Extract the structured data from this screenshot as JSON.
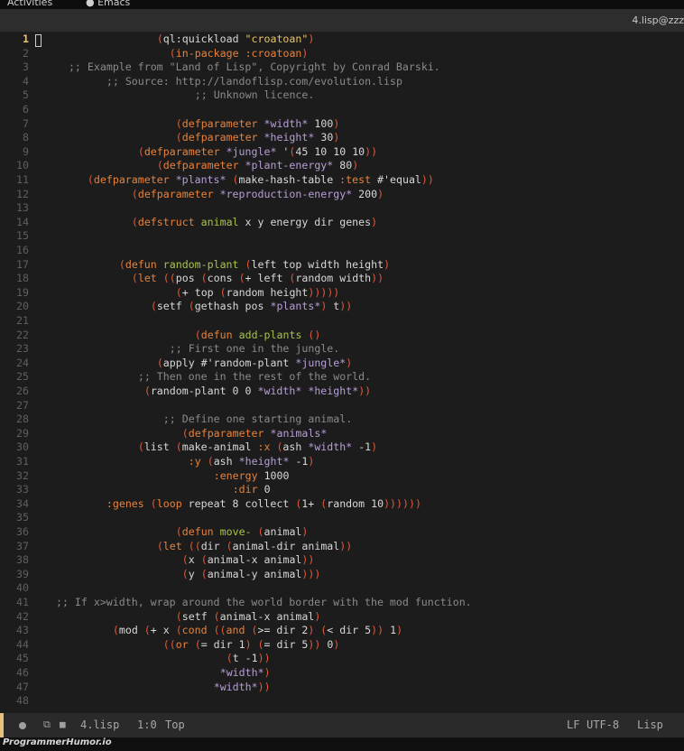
{
  "tab": {
    "title": "4.lisp@zzz"
  },
  "colors": {
    "background": "#1c1c1c",
    "paren": "#e05a3a",
    "keyword": "#e8823a",
    "function_name": "#a6c34a",
    "string": "#e9c46a",
    "comment": "#8a8a8a",
    "variable": "#b79fd6",
    "text": "#d8d8d8",
    "current_line_number": "#e8c07d"
  },
  "editor": {
    "current_line": 1,
    "lines": [
      {
        "n": "1",
        "indent": 18,
        "tokens": [
          [
            "p",
            "("
          ],
          [
            "t",
            "ql:quickload "
          ],
          [
            "s",
            "\"croatoan\""
          ],
          [
            "p",
            ")"
          ]
        ]
      },
      {
        "n": "2",
        "indent": 20,
        "tokens": [
          [
            "p",
            "("
          ],
          [
            "k",
            "in-package"
          ],
          [
            "t",
            " "
          ],
          [
            "k",
            ":croatoan"
          ],
          [
            "p",
            ")"
          ]
        ]
      },
      {
        "n": "3",
        "indent": 4,
        "tokens": [
          [
            "c",
            ";; Example from \"Land of Lisp\", Copyright by Conrad Barski."
          ]
        ]
      },
      {
        "n": "4",
        "indent": 10,
        "tokens": [
          [
            "c",
            ";; Source: http://landoflisp.com/evolution.lisp"
          ]
        ]
      },
      {
        "n": "5",
        "indent": 24,
        "tokens": [
          [
            "c",
            ";; Unknown licence."
          ]
        ]
      },
      {
        "n": "6",
        "indent": 0,
        "tokens": []
      },
      {
        "n": "7",
        "indent": 21,
        "tokens": [
          [
            "p",
            "("
          ],
          [
            "k",
            "defparameter"
          ],
          [
            "t",
            " "
          ],
          [
            "v",
            "*width*"
          ],
          [
            "t",
            " 100"
          ],
          [
            "p",
            ")"
          ]
        ]
      },
      {
        "n": "8",
        "indent": 21,
        "tokens": [
          [
            "p",
            "("
          ],
          [
            "k",
            "defparameter"
          ],
          [
            "t",
            " "
          ],
          [
            "v",
            "*height*"
          ],
          [
            "t",
            " 30"
          ],
          [
            "p",
            ")"
          ]
        ]
      },
      {
        "n": "9",
        "indent": 15,
        "tokens": [
          [
            "p",
            "("
          ],
          [
            "k",
            "defparameter"
          ],
          [
            "t",
            " "
          ],
          [
            "v",
            "*jungle*"
          ],
          [
            "t",
            " '"
          ],
          [
            "p",
            "("
          ],
          [
            "t",
            "45 10 10 10"
          ],
          [
            "p",
            "))"
          ]
        ]
      },
      {
        "n": "10",
        "indent": 18,
        "tokens": [
          [
            "p",
            "("
          ],
          [
            "k",
            "defparameter"
          ],
          [
            "t",
            " "
          ],
          [
            "v",
            "*plant-energy*"
          ],
          [
            "t",
            " 80"
          ],
          [
            "p",
            ")"
          ]
        ]
      },
      {
        "n": "11",
        "indent": 7,
        "tokens": [
          [
            "p",
            "("
          ],
          [
            "k",
            "defparameter"
          ],
          [
            "t",
            " "
          ],
          [
            "v",
            "*plants*"
          ],
          [
            "t",
            " "
          ],
          [
            "p",
            "("
          ],
          [
            "t",
            "make-hash-table "
          ],
          [
            "k",
            ":test"
          ],
          [
            "t",
            " #'equal"
          ],
          [
            "p",
            "))"
          ]
        ]
      },
      {
        "n": "12",
        "indent": 14,
        "tokens": [
          [
            "p",
            "("
          ],
          [
            "k",
            "defparameter"
          ],
          [
            "t",
            " "
          ],
          [
            "v",
            "*reproduction-energy*"
          ],
          [
            "t",
            " 200"
          ],
          [
            "p",
            ")"
          ]
        ]
      },
      {
        "n": "13",
        "indent": 0,
        "tokens": []
      },
      {
        "n": "14",
        "indent": 14,
        "tokens": [
          [
            "p",
            "("
          ],
          [
            "k",
            "defstruct"
          ],
          [
            "t",
            " "
          ],
          [
            "f",
            "animal"
          ],
          [
            "t",
            " x y energy dir genes"
          ],
          [
            "p",
            ")"
          ]
        ]
      },
      {
        "n": "15",
        "indent": 0,
        "tokens": []
      },
      {
        "n": "16",
        "indent": 0,
        "tokens": []
      },
      {
        "n": "17",
        "indent": 12,
        "tokens": [
          [
            "p",
            "("
          ],
          [
            "k",
            "defun"
          ],
          [
            "t",
            " "
          ],
          [
            "f",
            "random-plant"
          ],
          [
            "t",
            " "
          ],
          [
            "p",
            "("
          ],
          [
            "t",
            "left top width height"
          ],
          [
            "p",
            ")"
          ]
        ]
      },
      {
        "n": "18",
        "indent": 14,
        "tokens": [
          [
            "p",
            "("
          ],
          [
            "k",
            "let"
          ],
          [
            "t",
            " "
          ],
          [
            "p",
            "(("
          ],
          [
            "t",
            "pos "
          ],
          [
            "p",
            "("
          ],
          [
            "t",
            "cons "
          ],
          [
            "p",
            "("
          ],
          [
            "t",
            "+ left "
          ],
          [
            "p",
            "("
          ],
          [
            "t",
            "random width"
          ],
          [
            "p",
            "))"
          ]
        ]
      },
      {
        "n": "19",
        "indent": 21,
        "tokens": [
          [
            "p",
            "("
          ],
          [
            "t",
            "+ top "
          ],
          [
            "p",
            "("
          ],
          [
            "t",
            "random height"
          ],
          [
            "p",
            ")))))"
          ]
        ]
      },
      {
        "n": "20",
        "indent": 17,
        "tokens": [
          [
            "p",
            "("
          ],
          [
            "t",
            "setf "
          ],
          [
            "p",
            "("
          ],
          [
            "t",
            "gethash pos "
          ],
          [
            "v",
            "*plants*"
          ],
          [
            "p",
            ")"
          ],
          [
            "t",
            " t"
          ],
          [
            "p",
            "))"
          ]
        ]
      },
      {
        "n": "21",
        "indent": 0,
        "tokens": []
      },
      {
        "n": "22",
        "indent": 24,
        "tokens": [
          [
            "p",
            "("
          ],
          [
            "k",
            "defun"
          ],
          [
            "t",
            " "
          ],
          [
            "f",
            "add-plants"
          ],
          [
            "t",
            " "
          ],
          [
            "p",
            "()"
          ]
        ]
      },
      {
        "n": "23",
        "indent": 20,
        "tokens": [
          [
            "c",
            ";; First one in the jungle."
          ]
        ]
      },
      {
        "n": "24",
        "indent": 18,
        "tokens": [
          [
            "p",
            "("
          ],
          [
            "t",
            "apply #'random-plant "
          ],
          [
            "v",
            "*jungle*"
          ],
          [
            "p",
            ")"
          ]
        ]
      },
      {
        "n": "25",
        "indent": 15,
        "tokens": [
          [
            "c",
            ";; Then one in the rest of the world."
          ]
        ]
      },
      {
        "n": "26",
        "indent": 16,
        "tokens": [
          [
            "p",
            "("
          ],
          [
            "t",
            "random-plant 0 0 "
          ],
          [
            "v",
            "*width*"
          ],
          [
            "t",
            " "
          ],
          [
            "v",
            "*height*"
          ],
          [
            "p",
            "))"
          ]
        ]
      },
      {
        "n": "27",
        "indent": 0,
        "tokens": []
      },
      {
        "n": "28",
        "indent": 19,
        "tokens": [
          [
            "c",
            ";; Define one starting animal."
          ]
        ]
      },
      {
        "n": "29",
        "indent": 22,
        "tokens": [
          [
            "p",
            "("
          ],
          [
            "k",
            "defparameter"
          ],
          [
            "t",
            " "
          ],
          [
            "v",
            "*animals*"
          ]
        ]
      },
      {
        "n": "30",
        "indent": 15,
        "tokens": [
          [
            "p",
            "("
          ],
          [
            "t",
            "list "
          ],
          [
            "p",
            "("
          ],
          [
            "t",
            "make-animal "
          ],
          [
            "k",
            ":x"
          ],
          [
            "t",
            " "
          ],
          [
            "p",
            "("
          ],
          [
            "t",
            "ash "
          ],
          [
            "v",
            "*width*"
          ],
          [
            "t",
            " -1"
          ],
          [
            "p",
            ")"
          ]
        ]
      },
      {
        "n": "31",
        "indent": 23,
        "tokens": [
          [
            "k",
            ":y"
          ],
          [
            "t",
            " "
          ],
          [
            "p",
            "("
          ],
          [
            "t",
            "ash "
          ],
          [
            "v",
            "*height*"
          ],
          [
            "t",
            " -1"
          ],
          [
            "p",
            ")"
          ]
        ]
      },
      {
        "n": "32",
        "indent": 27,
        "tokens": [
          [
            "k",
            ":energy"
          ],
          [
            "t",
            " 1000"
          ]
        ]
      },
      {
        "n": "33",
        "indent": 30,
        "tokens": [
          [
            "k",
            ":dir"
          ],
          [
            "t",
            " 0"
          ]
        ]
      },
      {
        "n": "34",
        "indent": 10,
        "tokens": [
          [
            "k",
            ":genes"
          ],
          [
            "t",
            " "
          ],
          [
            "p",
            "("
          ],
          [
            "k",
            "loop"
          ],
          [
            "t",
            " repeat 8 collect "
          ],
          [
            "p",
            "("
          ],
          [
            "t",
            "1+ "
          ],
          [
            "p",
            "("
          ],
          [
            "t",
            "random 10"
          ],
          [
            "p",
            "))))))"
          ]
        ]
      },
      {
        "n": "35",
        "indent": 0,
        "tokens": []
      },
      {
        "n": "36",
        "indent": 21,
        "tokens": [
          [
            "p",
            "("
          ],
          [
            "k",
            "defun"
          ],
          [
            "t",
            " "
          ],
          [
            "f",
            "move-"
          ],
          [
            "t",
            " "
          ],
          [
            "p",
            "("
          ],
          [
            "t",
            "animal"
          ],
          [
            "p",
            ")"
          ]
        ]
      },
      {
        "n": "37",
        "indent": 18,
        "tokens": [
          [
            "p",
            "("
          ],
          [
            "k",
            "let"
          ],
          [
            "t",
            " "
          ],
          [
            "p",
            "(("
          ],
          [
            "t",
            "dir "
          ],
          [
            "p",
            "("
          ],
          [
            "t",
            "animal-dir animal"
          ],
          [
            "p",
            "))"
          ]
        ]
      },
      {
        "n": "38",
        "indent": 22,
        "tokens": [
          [
            "p",
            "("
          ],
          [
            "t",
            "x "
          ],
          [
            "p",
            "("
          ],
          [
            "t",
            "animal-x animal"
          ],
          [
            "p",
            "))"
          ]
        ]
      },
      {
        "n": "39",
        "indent": 22,
        "tokens": [
          [
            "p",
            "("
          ],
          [
            "t",
            "y "
          ],
          [
            "p",
            "("
          ],
          [
            "t",
            "animal-y animal"
          ],
          [
            "p",
            ")))"
          ]
        ]
      },
      {
        "n": "40",
        "indent": 0,
        "tokens": []
      },
      {
        "n": "41",
        "indent": 2,
        "tokens": [
          [
            "c",
            ";; If x>width, wrap around the world border with the mod function."
          ]
        ]
      },
      {
        "n": "42",
        "indent": 21,
        "tokens": [
          [
            "p",
            "("
          ],
          [
            "t",
            "setf "
          ],
          [
            "p",
            "("
          ],
          [
            "t",
            "animal-x animal"
          ],
          [
            "p",
            ")"
          ]
        ]
      },
      {
        "n": "43",
        "indent": 11,
        "tokens": [
          [
            "p",
            "("
          ],
          [
            "t",
            "mod "
          ],
          [
            "p",
            "("
          ],
          [
            "t",
            "+ x "
          ],
          [
            "p",
            "("
          ],
          [
            "k",
            "cond"
          ],
          [
            "t",
            " "
          ],
          [
            "p",
            "(("
          ],
          [
            "k",
            "and"
          ],
          [
            "t",
            " "
          ],
          [
            "p",
            "("
          ],
          [
            "t",
            ">= dir 2"
          ],
          [
            "p",
            ")"
          ],
          [
            "t",
            " "
          ],
          [
            "p",
            "("
          ],
          [
            "t",
            "< dir 5"
          ],
          [
            "p",
            "))"
          ],
          [
            "t",
            " 1"
          ],
          [
            "p",
            ")"
          ]
        ]
      },
      {
        "n": "44",
        "indent": 19,
        "tokens": [
          [
            "p",
            "(("
          ],
          [
            "k",
            "or"
          ],
          [
            "t",
            " "
          ],
          [
            "p",
            "("
          ],
          [
            "t",
            "= dir 1"
          ],
          [
            "p",
            ")"
          ],
          [
            "t",
            " "
          ],
          [
            "p",
            "("
          ],
          [
            "t",
            "= dir 5"
          ],
          [
            "p",
            "))"
          ],
          [
            "t",
            " 0"
          ],
          [
            "p",
            ")"
          ]
        ]
      },
      {
        "n": "45",
        "indent": 29,
        "tokens": [
          [
            "p",
            "("
          ],
          [
            "t",
            "t -1"
          ],
          [
            "p",
            "))"
          ]
        ]
      },
      {
        "n": "46",
        "indent": 28,
        "tokens": [
          [
            "v",
            "*width*"
          ],
          [
            "p",
            ")"
          ]
        ]
      },
      {
        "n": "47",
        "indent": 27,
        "tokens": [
          [
            "v",
            "*width*"
          ],
          [
            "p",
            "))"
          ]
        ]
      },
      {
        "n": "48",
        "indent": 0,
        "tokens": []
      }
    ]
  },
  "status": {
    "filename": "4.lisp",
    "position": "1:0",
    "scroll": "Top",
    "line_ending": "LF",
    "encoding": "UTF-8",
    "mode": "Lisp"
  },
  "watermark": "ProgrammerHumor.io"
}
